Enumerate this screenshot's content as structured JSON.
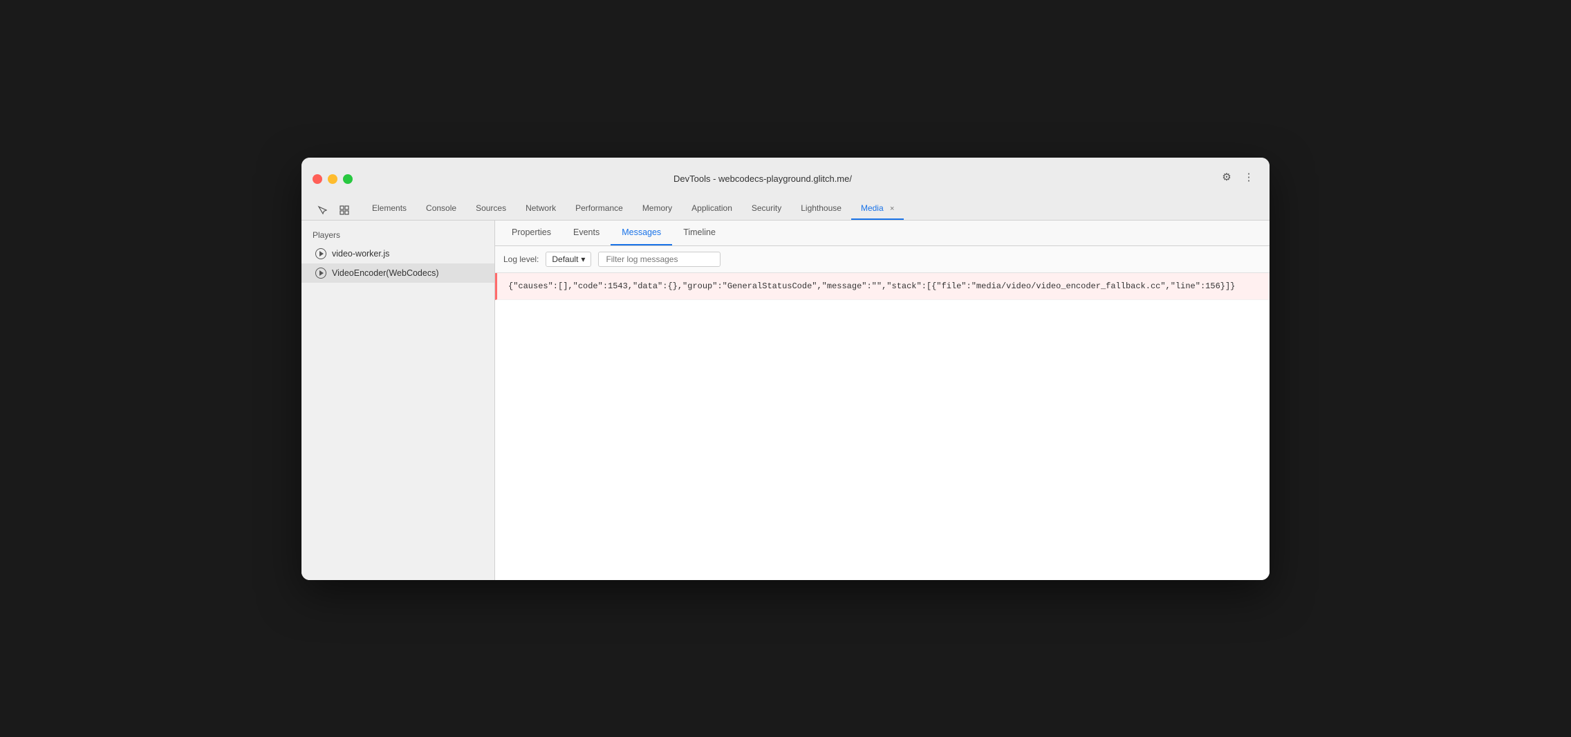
{
  "window": {
    "title": "DevTools - webcodecs-playground.glitch.me/"
  },
  "traffic_lights": {
    "red": "red",
    "yellow": "yellow",
    "green": "green"
  },
  "devtools_tabs": [
    {
      "id": "elements",
      "label": "Elements",
      "active": false
    },
    {
      "id": "console",
      "label": "Console",
      "active": false
    },
    {
      "id": "sources",
      "label": "Sources",
      "active": false
    },
    {
      "id": "network",
      "label": "Network",
      "active": false
    },
    {
      "id": "performance",
      "label": "Performance",
      "active": false
    },
    {
      "id": "memory",
      "label": "Memory",
      "active": false
    },
    {
      "id": "application",
      "label": "Application",
      "active": false
    },
    {
      "id": "security",
      "label": "Security",
      "active": false
    },
    {
      "id": "lighthouse",
      "label": "Lighthouse",
      "active": false
    },
    {
      "id": "media",
      "label": "Media",
      "active": true,
      "closable": true
    }
  ],
  "sidebar": {
    "header": "Players",
    "items": [
      {
        "id": "video-worker",
        "label": "video-worker.js",
        "selected": false
      },
      {
        "id": "video-encoder",
        "label": "VideoEncoder(WebCodecs)",
        "selected": true
      }
    ]
  },
  "content_tabs": [
    {
      "id": "properties",
      "label": "Properties",
      "active": false
    },
    {
      "id": "events",
      "label": "Events",
      "active": false
    },
    {
      "id": "messages",
      "label": "Messages",
      "active": true
    },
    {
      "id": "timeline",
      "label": "Timeline",
      "active": false
    }
  ],
  "log_toolbar": {
    "level_label": "Log level:",
    "level_value": "Default",
    "filter_placeholder": "Filter log messages"
  },
  "log_entries": [
    {
      "id": "entry-1",
      "type": "error",
      "text": "{\"causes\":[],\"code\":1543,\"data\":{},\"group\":\"GeneralStatusCode\",\"message\":\"\",\"stack\":[{\"file\":\"media/video/video_encoder_fallback.cc\",\"line\":156}]}"
    }
  ],
  "icons": {
    "cursor": "⬡",
    "inspector": "☰",
    "settings": "⚙",
    "more": "⋮",
    "chevron_down": "▾"
  }
}
